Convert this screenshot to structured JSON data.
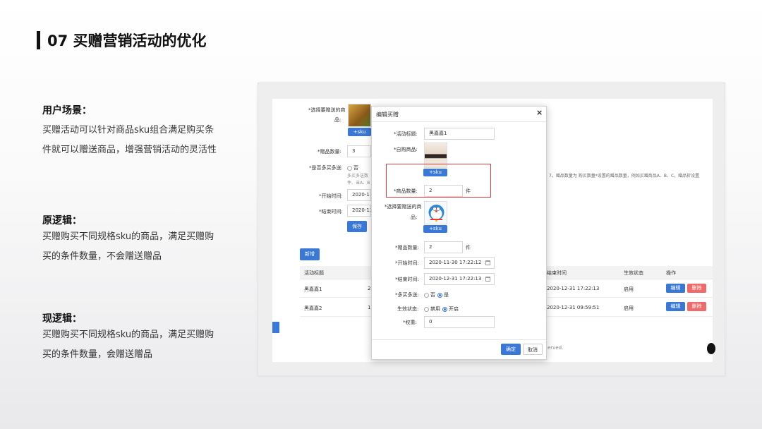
{
  "slide": {
    "title": "07 买赠营销活动的优化",
    "sections": [
      {
        "heading": "用户场景：",
        "lines": [
          "买赠活动可以针对商品sku组合满足购买条",
          "件就可以赠送商品，增强营销活动的灵活性"
        ]
      },
      {
        "heading": "原逻辑：",
        "lines": [
          "买赠购买不同规格sku的商品，满足买赠购",
          "买的条件数量，不会赠送赠品"
        ]
      },
      {
        "heading": "现逻辑：",
        "lines": [
          "买赠购买不同规格sku的商品，满足买赠购",
          "买的条件数量，会赠送赠品"
        ]
      }
    ]
  },
  "bg_form": {
    "gift_label": "*选择要赠送的商",
    "gift_label2": "品:",
    "sku_btn": "+sku",
    "gift_qty_label": "*赠品数量:",
    "gift_qty_value": "3",
    "multi_label": "*是否多买多送:",
    "multi_opt_no": "否",
    "hint1": "多买多送数",
    "hint2": "件、当A、B",
    "hint_right": "7。赠品数量为 购买数量*设置的赠品数量，例如买赠商品A、B、C，赠品折设置",
    "start_label": "*开始时间:",
    "start_value": "2020-11-",
    "end_label": "*结束时间:",
    "end_value": "2020-12-",
    "save_btn": "保存",
    "add_btn": "新增"
  },
  "table": {
    "headers": [
      "活动标题",
      "结束时间",
      "生效状态",
      "操作"
    ],
    "rows": [
      {
        "title": "黑嘉嘉1",
        "col2": "2",
        "end": "2020-12-31 17:22:13",
        "status": "启用",
        "edit": "编辑",
        "del": "删除"
      },
      {
        "title": "黑嘉嘉2",
        "col2": "1",
        "end": "2020-12-31 09:59:51",
        "status": "启用",
        "edit": "编辑",
        "del": "删除"
      }
    ],
    "footer": "erved."
  },
  "modal": {
    "title": "编辑买赠",
    "close": "×",
    "activity_title_label": "*活动标题:",
    "activity_title_value": "黑嘉嘉1",
    "buy_goods_label": "*自购商品:",
    "sku_btn": "+sku",
    "goods_qty_label": "*商品数量:",
    "goods_qty_value": "2",
    "unit": "件",
    "gift_label": "*选择要赠送的商",
    "gift_label2": "品:",
    "gift_sku_btn": "+sku",
    "gift_qty_label": "*赠品数量:",
    "gift_qty_value": "2",
    "gift_unit": "件",
    "start_label": "*开始时间:",
    "start_value": "2020-11-30 17:22:12",
    "end_label": "*结束时间:",
    "end_value": "2020-12-31 17:22:13",
    "multi_label": "*多买多送:",
    "multi_no": "否",
    "multi_yes": "是",
    "status_label": "生效状态:",
    "status_off": "禁用",
    "status_on": "开启",
    "weight_label": "*权重:",
    "weight_value": "0",
    "ok_btn": "确定",
    "cancel_btn": "取消"
  }
}
